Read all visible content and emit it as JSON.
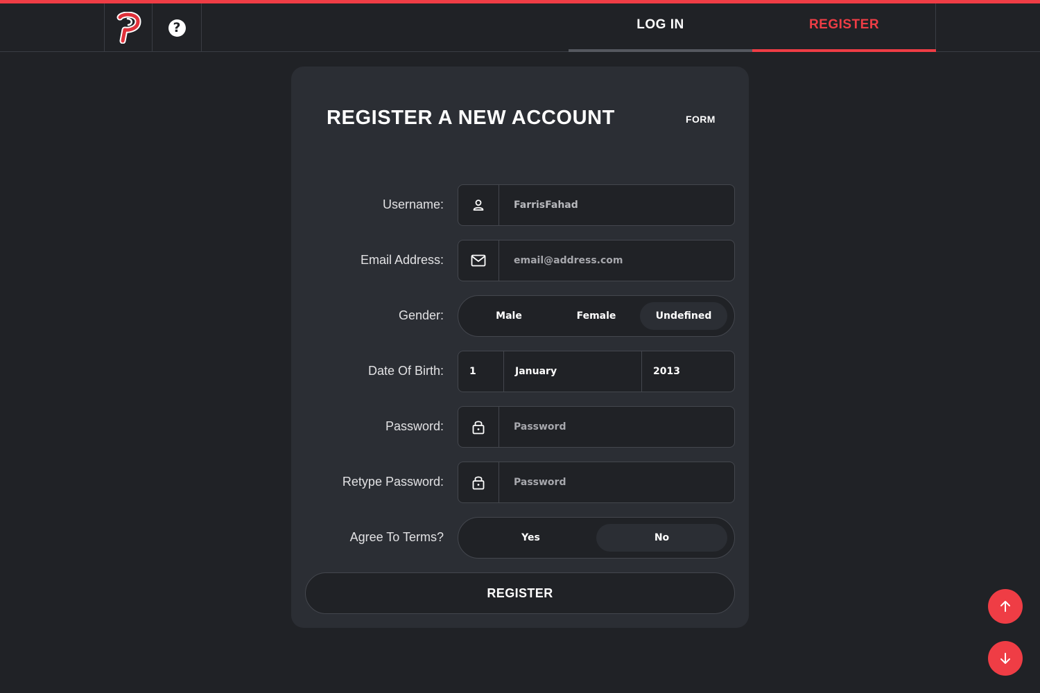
{
  "header": {
    "logo_icon": "p-logo-icon",
    "help_icon_glyph": "?",
    "tabs": [
      {
        "label": "LOG IN",
        "active": false
      },
      {
        "label": "REGISTER",
        "active": true
      }
    ],
    "accent_color": "#ef3d45"
  },
  "form": {
    "title": "REGISTER A NEW ACCOUNT",
    "tag": "FORM",
    "username": {
      "label": "Username:",
      "value": "FarrisFahad",
      "icon": "user-icon"
    },
    "email": {
      "label": "Email Address:",
      "placeholder": "email@address.com",
      "icon": "mail-icon"
    },
    "gender": {
      "label": "Gender:",
      "options": [
        "Male",
        "Female",
        "Undefined"
      ],
      "selected": "Undefined"
    },
    "dob": {
      "label": "Date Of Birth:",
      "day": "1",
      "month": "January",
      "year": "2013"
    },
    "password": {
      "label": "Password:",
      "placeholder": "Password",
      "icon": "lock-icon"
    },
    "retype_password": {
      "label": "Retype Password:",
      "placeholder": "Password",
      "icon": "lock-icon"
    },
    "terms": {
      "label": "Agree To Terms?",
      "options": [
        "Yes",
        "No"
      ],
      "selected": "No"
    },
    "submit_label": "REGISTER"
  },
  "scroll": {
    "up_icon": "arrow-up-icon",
    "down_icon": "arrow-down-icon"
  }
}
